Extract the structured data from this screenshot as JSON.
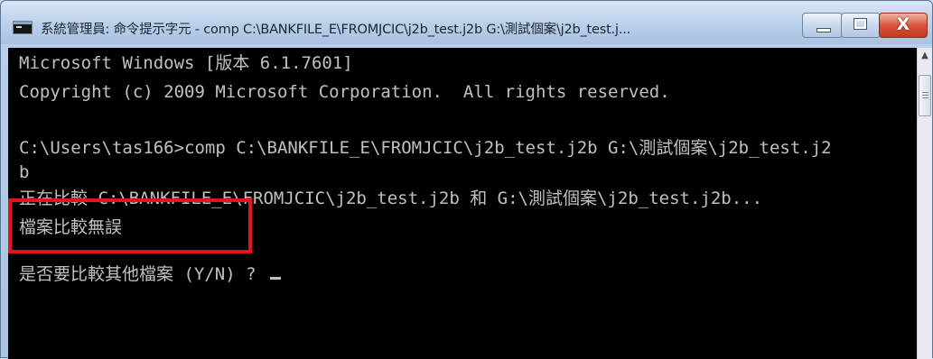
{
  "window": {
    "title": "系統管理員: 命令提示字元 - comp C:\\BANKFILE_E\\FROMJCIC\\j2b_test.j2b G:\\測試個案\\j2b_test.j...",
    "icon": "cmd-icon"
  },
  "controls": {
    "minimize_icon": "minimize-icon",
    "maximize_icon": "maximize-icon",
    "close_label": "X"
  },
  "console": {
    "lines": [
      "Microsoft Windows [版本 6.1.7601]",
      "Copyright (c) 2009 Microsoft Corporation.  All rights reserved.",
      "",
      "C:\\Users\\tas166>comp C:\\BANKFILE_E\\FROMJCIC\\j2b_test.j2b G:\\測試個案\\j2b_test.j2",
      "b",
      "正在比較 C:\\BANKFILE_E\\FROMJCIC\\j2b_test.j2b 和 G:\\測試個案\\j2b_test.j2b...",
      "檔案比較無誤",
      "",
      "是否要比較其他檔案 (Y/N) ? "
    ],
    "text_color": "#c0c0c0",
    "background": "#000000"
  },
  "annotation": {
    "color": "#e3141c"
  }
}
